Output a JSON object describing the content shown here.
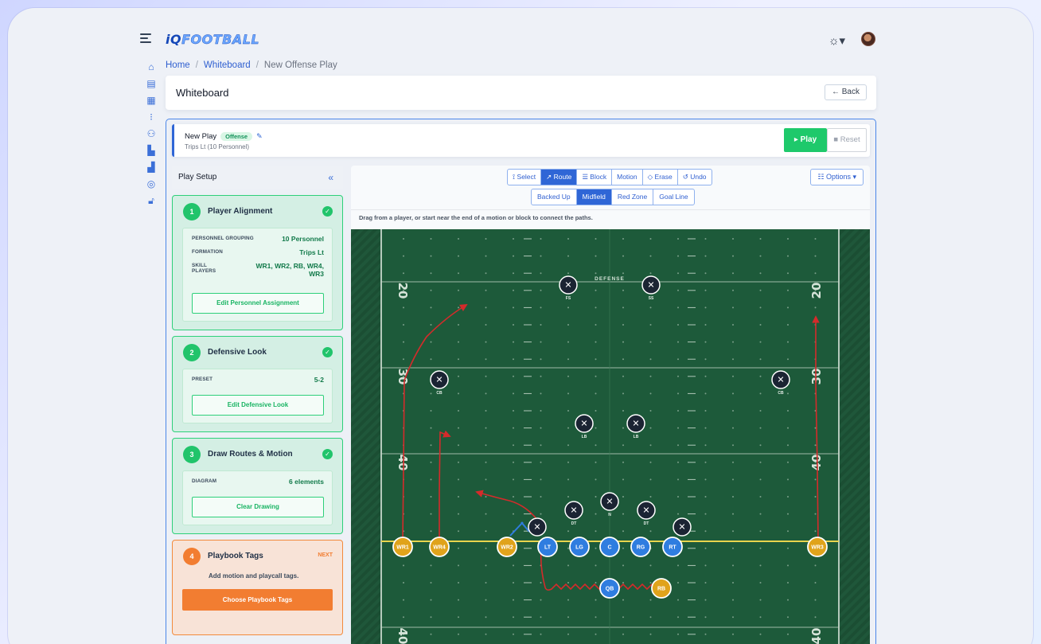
{
  "brand": {
    "logo_iq": "iQ",
    "logo_football": "FOOTBALL"
  },
  "breadcrumb": {
    "home": "Home",
    "whiteboard": "Whiteboard",
    "current": "New Offense Play"
  },
  "page": {
    "title": "Whiteboard",
    "back": "← Back"
  },
  "play": {
    "name": "New Play",
    "badge": "Offense",
    "subtitle": "Trips Lt (10 Personnel)",
    "play_label": "▸ Play",
    "reset_label": "■ Reset"
  },
  "setup": {
    "title": "Play Setup",
    "collapse": "«",
    "steps": [
      {
        "num": "1",
        "name": "Player Alignment",
        "status": "done",
        "rows": [
          {
            "key": "Personnel Grouping",
            "value": "10 Personnel"
          },
          {
            "key": "Formation",
            "value": "Trips Lt"
          },
          {
            "key": "Skill Players",
            "value": "WR1, WR2, RB, WR4, WR3"
          }
        ],
        "button": "Edit Personnel Assignment"
      },
      {
        "num": "2",
        "name": "Defensive Look",
        "status": "done",
        "rows": [
          {
            "key": "Preset",
            "value": "5-2"
          }
        ],
        "button": "Edit Defensive Look"
      },
      {
        "num": "3",
        "name": "Draw Routes & Motion",
        "status": "done",
        "rows": [
          {
            "key": "Diagram",
            "value": "6 elements"
          }
        ],
        "button": "Clear Drawing"
      },
      {
        "num": "4",
        "name": "Playbook Tags",
        "status": "NEXT",
        "desc": "Add motion and playcall tags.",
        "button": "Choose Playbook Tags"
      }
    ]
  },
  "toolbar": {
    "tools": [
      "⟟ Select",
      "↗ Route",
      "☰ Block",
      "Motion",
      "◇ Erase",
      "↺ Undo"
    ],
    "active_tool": "↗ Route",
    "zones": [
      "Backed Up",
      "Midfield",
      "Red Zone",
      "Goal Line"
    ],
    "active_zone": "Midfield",
    "options": "☷ Options ▾"
  },
  "hint": "Drag from a player, or start near the end of a motion or block to connect the paths.",
  "colors": {
    "field": "#1d5a3a",
    "offense_skill": "#e0a31b",
    "offense_line": "#2f7de0",
    "defense": "#1b2433",
    "route": "#d42b2b",
    "los": "#e8d44d",
    "accent": "#2f66d6",
    "success": "#21c46b",
    "warning": "#f27d31"
  },
  "field": {
    "defense_label": "DEFENSE",
    "yard_numbers_left": [
      "20",
      "30",
      "40",
      "40"
    ],
    "yard_numbers_right": [
      "20",
      "30",
      "40",
      "40"
    ],
    "offense": [
      {
        "id": "WR1",
        "type": "skill"
      },
      {
        "id": "WR4",
        "type": "skill"
      },
      {
        "id": "WR2",
        "type": "skill"
      },
      {
        "id": "LT",
        "type": "line"
      },
      {
        "id": "LG",
        "type": "line"
      },
      {
        "id": "C",
        "type": "line"
      },
      {
        "id": "RG",
        "type": "line"
      },
      {
        "id": "RT",
        "type": "line"
      },
      {
        "id": "WR3",
        "type": "skill"
      },
      {
        "id": "QB",
        "type": "line"
      },
      {
        "id": "RB",
        "type": "skill"
      }
    ],
    "defense": [
      "FS",
      "SS",
      "CB",
      "CB",
      "LB",
      "LB",
      "DT",
      "N",
      "DT",
      "",
      ""
    ]
  }
}
